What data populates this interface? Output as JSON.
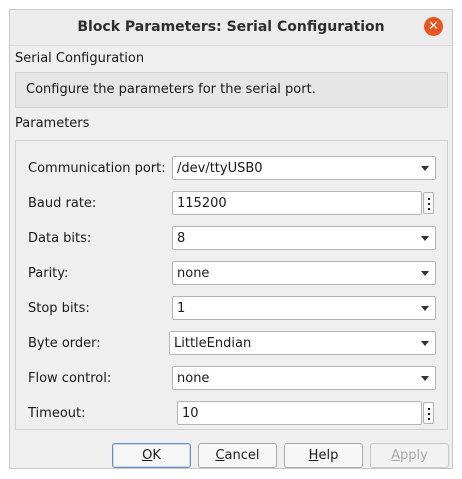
{
  "window": {
    "title": "Block Parameters: Serial Configuration",
    "close_symbol": "✕"
  },
  "block": {
    "name": "Serial Configuration",
    "description": "Configure the parameters for the serial port."
  },
  "parameters": {
    "section_label": "Parameters",
    "communication_port": {
      "label": "Communication port:",
      "value": "/dev/ttyUSB0"
    },
    "baud_rate": {
      "label": "Baud rate:",
      "value": "115200"
    },
    "data_bits": {
      "label": "Data bits:",
      "value": "8"
    },
    "parity": {
      "label": "Parity:",
      "value": "none"
    },
    "stop_bits": {
      "label": "Stop bits:",
      "value": "1"
    },
    "byte_order": {
      "label": "Byte order:",
      "value": "LittleEndian"
    },
    "flow_control": {
      "label": "Flow control:",
      "value": "none"
    },
    "timeout": {
      "label": "Timeout:",
      "value": "10"
    }
  },
  "buttons": {
    "ok": {
      "prefix": "",
      "mnemonic": "O",
      "rest": "K"
    },
    "cancel": {
      "prefix": "",
      "mnemonic": "C",
      "rest": "ancel"
    },
    "help": {
      "prefix": "",
      "mnemonic": "H",
      "rest": "elp"
    },
    "apply": {
      "prefix": "",
      "mnemonic": "A",
      "rest": "pply"
    }
  },
  "colors": {
    "close_button": "#e95420",
    "dialog_background": "#efefef"
  },
  "icons": [
    "close-icon",
    "dropdown-arrow-icon",
    "more-options-icon"
  ]
}
